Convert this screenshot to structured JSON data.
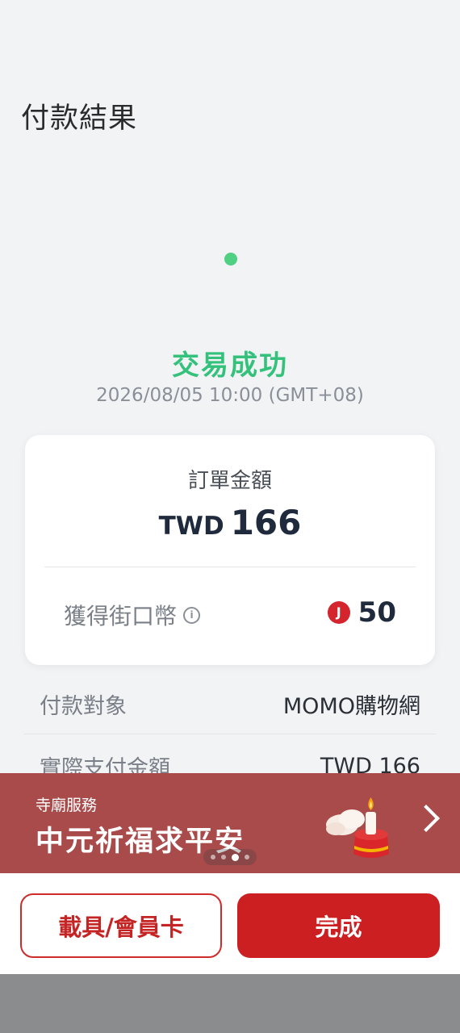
{
  "header": {
    "title": "付款結果"
  },
  "status": {
    "title": "交易成功",
    "timestamp": "2026/08/05 10:00 (GMT+08)",
    "color": "#34c17b"
  },
  "order": {
    "label": "訂單金額",
    "currency": "TWD",
    "amount": "166",
    "coins_label": "獲得街口幣",
    "coin_icon_letter": "J",
    "coins": "50"
  },
  "details": [
    {
      "key": "付款對象",
      "value": "MOMO購物網"
    },
    {
      "key": "實際支付金額",
      "value": "TWD 166"
    }
  ],
  "banner": {
    "subtitle": "寺廟服務",
    "title": "中元祈福求平安",
    "color": "#a94b4b",
    "icon": "candle-offering-icon"
  },
  "pager": {
    "count": 4,
    "active": 2
  },
  "actions": {
    "secondary_label": "載具/會員卡",
    "primary_label": "完成",
    "accent": "#cc1f22"
  }
}
